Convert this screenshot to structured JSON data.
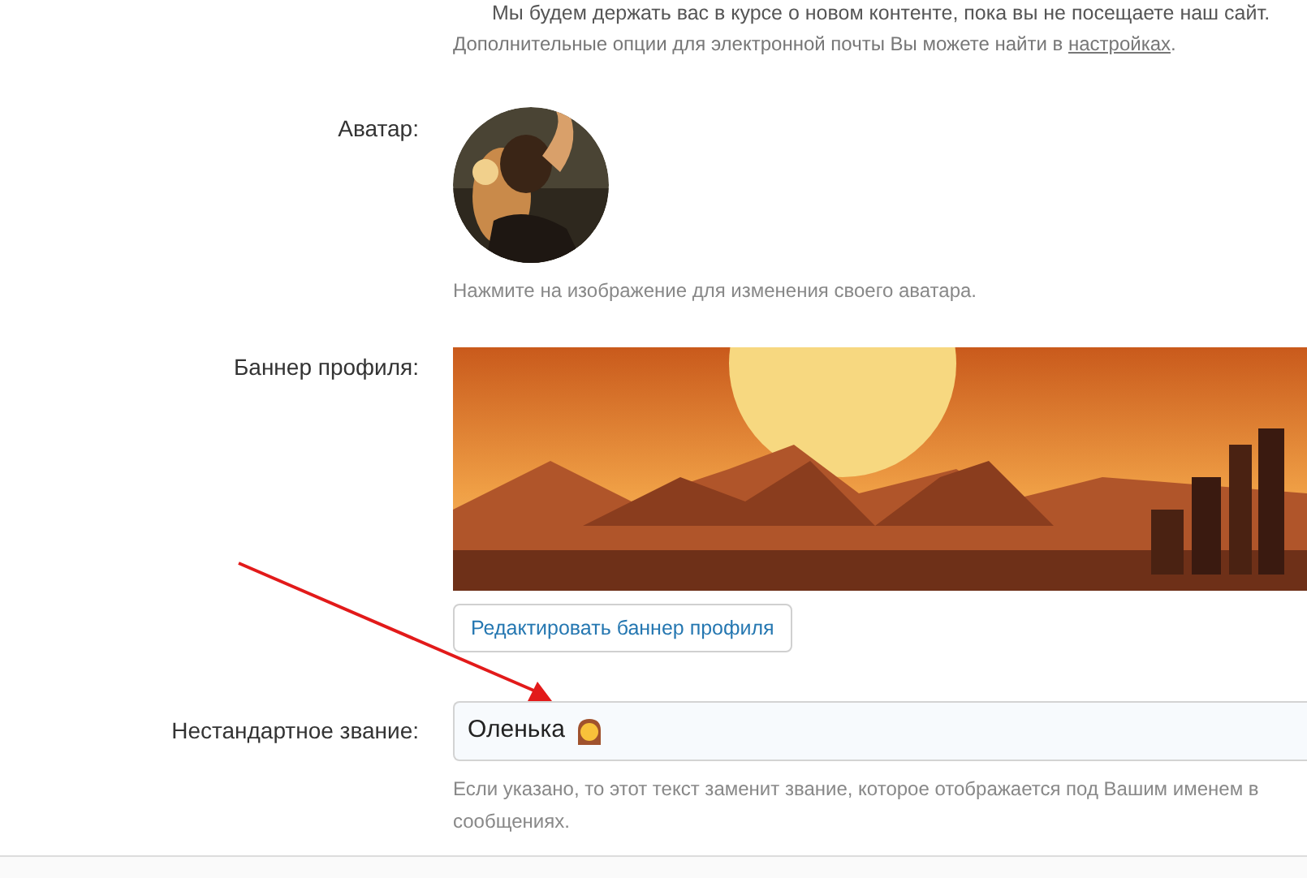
{
  "email_note": {
    "text": "Мы будем держать вас в курсе о новом контенте, пока вы не посещаете наш сайт.",
    "options_text": "Дополнительные опции для электронной почты Вы можете найти в ",
    "options_link": "настройках",
    "options_end": "."
  },
  "avatar": {
    "label": "Аватар:",
    "hint": "Нажмите на изображение для изменения своего аватара."
  },
  "banner": {
    "label": "Баннер профиля:",
    "button": "Редактировать баннер профиля"
  },
  "custom_title": {
    "label": "Нестандартное звание:",
    "value": "Оленька",
    "hint": "Если указано, то этот текст заменит звание, которое отображается под Вашим именем в сообщениях."
  }
}
